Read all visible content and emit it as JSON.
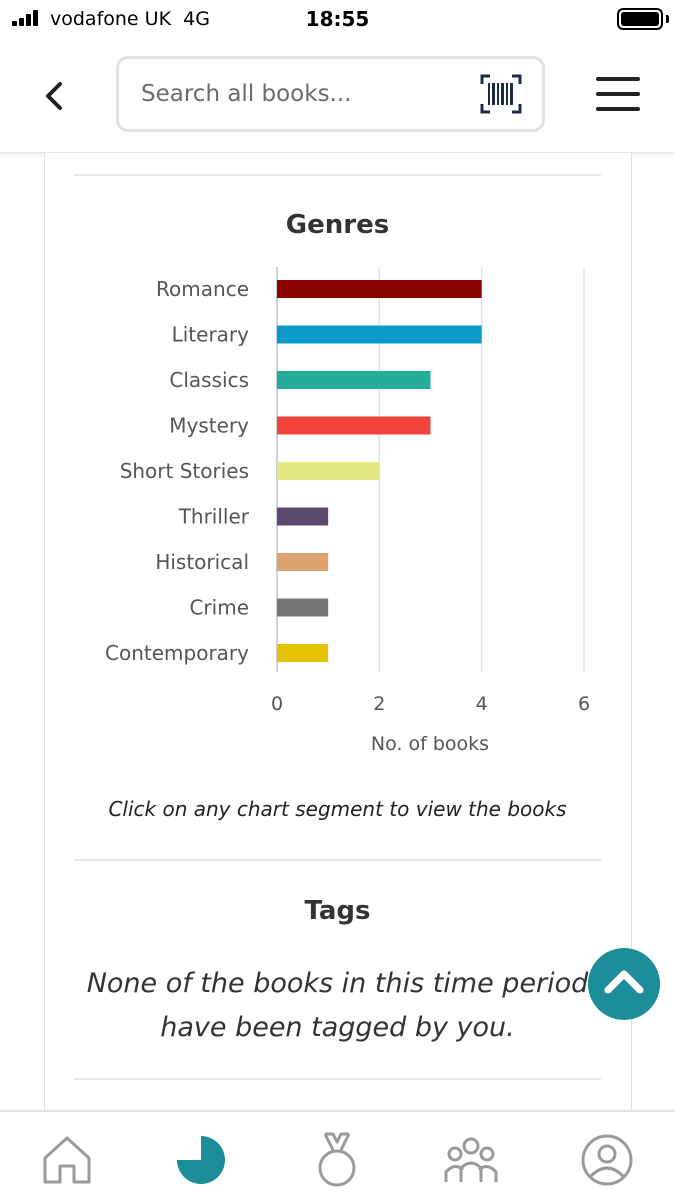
{
  "status_bar": {
    "carrier": "vodafone UK",
    "network": "4G",
    "time": "18:55"
  },
  "header": {
    "search_placeholder": "Search all books..."
  },
  "genres": {
    "title": "Genres",
    "caption": "Click on any chart segment to view the books"
  },
  "chart_data": {
    "type": "bar",
    "orientation": "horizontal",
    "title": "Genres",
    "xlabel": "No. of books",
    "ylabel": "",
    "xlim": [
      0,
      6
    ],
    "xticks": [
      0,
      2,
      4,
      6
    ],
    "grid": true,
    "legend": "none",
    "categories": [
      "Romance",
      "Literary",
      "Classics",
      "Mystery",
      "Short Stories",
      "Thriller",
      "Historical",
      "Crime",
      "Contemporary"
    ],
    "values": [
      4,
      4,
      3,
      3,
      2,
      1,
      1,
      1,
      1
    ],
    "colors": [
      "#8b0000",
      "#0b99c8",
      "#22ae9b",
      "#f1433a",
      "#e4e883",
      "#5c4a6e",
      "#dea172",
      "#747474",
      "#e6c300"
    ]
  },
  "tags": {
    "title": "Tags",
    "empty_message": "None of the books in this time period have been tagged by you."
  },
  "colors": {
    "accent": "#1d8e99",
    "nav_icon": "#9a9a9a"
  },
  "bottom_nav": {
    "items": [
      {
        "icon": "home-icon",
        "active": false
      },
      {
        "icon": "stats-pie-icon",
        "active": true
      },
      {
        "icon": "medal-icon",
        "active": false
      },
      {
        "icon": "community-icon",
        "active": false
      },
      {
        "icon": "profile-icon",
        "active": false
      }
    ]
  }
}
